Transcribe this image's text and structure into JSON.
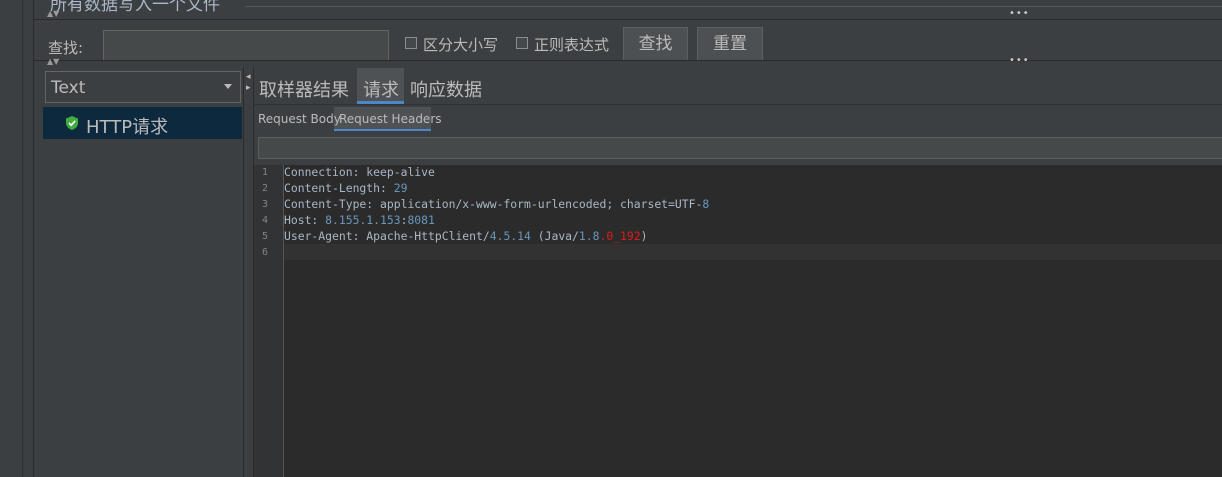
{
  "top": {
    "title": "所有数据写入一个文件"
  },
  "search": {
    "label": "查找:",
    "value": "",
    "case_label": "区分大小写",
    "regex_label": "正则表达式",
    "find_button": "查找",
    "reset_button": "重置"
  },
  "left": {
    "combo_value": "Text",
    "tree_item": "HTTP请求"
  },
  "tabs": {
    "t1": "取样器结果",
    "t2": "请求",
    "t3": "响应数据"
  },
  "subtabs": {
    "s1": "Request Body",
    "s2": "Request Headers"
  },
  "filter": {
    "value": ""
  },
  "lines": {
    "n1": "1",
    "n2": "2",
    "n3": "3",
    "n4": "4",
    "n5": "5",
    "n6": "6",
    "l1": "Connection: keep-alive",
    "l2a": "Content-Length: ",
    "l2b": "29",
    "l3a": "Content-Type: application/x-www-form-urlencoded; charset=UTF-",
    "l3b": "8",
    "l4a": "Host: ",
    "l4b": "8.155.1.153",
    "l4c": ":",
    "l4d": "8081",
    "l5a": "User-Agent: Apache-HttpClient/",
    "l5b": "4.5.14",
    "l5c": " (Java/",
    "l5d": "1.8",
    "l5e": ".",
    "l5f": "0_192",
    "l5g": ")"
  },
  "colors": {
    "background": "#3c3f41",
    "editor": "#2b2b2b",
    "selection": "#0d293e",
    "accent": "#4a88c7",
    "number": "#6897bb",
    "red": "#e11a1a"
  },
  "icons": {
    "tree_item_icon": "shield-check-icon",
    "combo_icon": "chevron-down-icon"
  }
}
